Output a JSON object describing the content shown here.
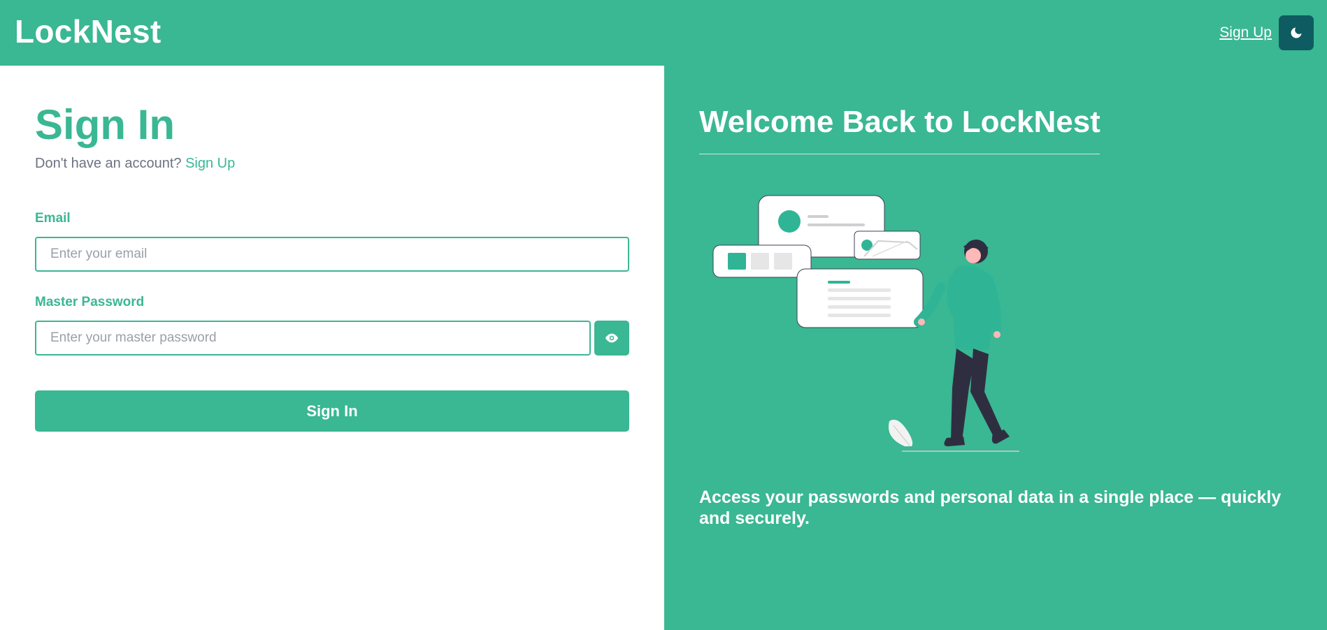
{
  "header": {
    "brand": "LockNest",
    "signup_link": "Sign Up",
    "theme_toggle_icon": "moon-icon"
  },
  "signin": {
    "title": "Sign In",
    "prompt": "Don't have an account?",
    "signup_link": "Sign Up",
    "email": {
      "label": "Email",
      "placeholder": "Enter your email",
      "value": ""
    },
    "password": {
      "label": "Master Password",
      "placeholder": "Enter your master password",
      "value": "",
      "toggle_icon": "eye-icon"
    },
    "submit_label": "Sign In"
  },
  "hero": {
    "heading": "Welcome Back to LockNest",
    "tagline": "Access your passwords and personal data in a single place — quickly and securely.",
    "illustration_icon": "person-with-cards-illustration"
  },
  "colors": {
    "primary": "#3ab793",
    "dark_button": "#0e5c62",
    "muted_text": "#6b7280"
  }
}
